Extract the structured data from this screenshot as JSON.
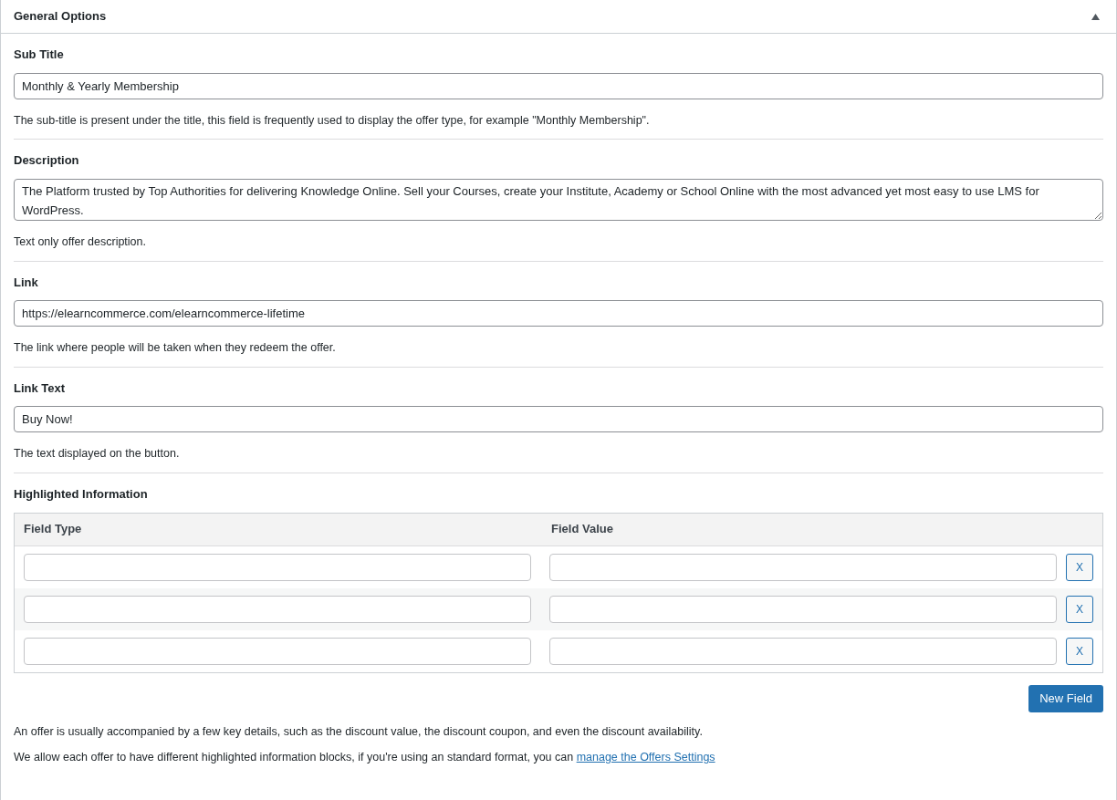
{
  "panel": {
    "title": "General Options",
    "expanded": true
  },
  "fields": [
    {
      "kind": "input",
      "label": "Sub Title",
      "value": "Monthly & Yearly Membership",
      "help": "The sub-title is present under the title, this field is frequently used to display the offer type, for example \"Monthly Membership\"."
    },
    {
      "kind": "textarea",
      "label": "Description",
      "value": "The Platform trusted by Top Authorities for delivering Knowledge Online. Sell your Courses, create your Institute, Academy or School Online with the most advanced yet most easy to use LMS for WordPress.",
      "help": "Text only offer description."
    },
    {
      "kind": "input",
      "label": "Link",
      "value": "https://elearncommerce.com/elearncommerce-lifetime",
      "help": "The link where people will be taken when they redeem the offer."
    },
    {
      "kind": "input",
      "label": "Link Text",
      "value": "Buy Now!",
      "help": "The text displayed on the button."
    }
  ],
  "highlighted": {
    "label": "Highlighted Information",
    "columns": [
      "Field Type",
      "Field Value"
    ],
    "rows": [
      {
        "remove": "X"
      },
      {
        "remove": "X"
      },
      {
        "remove": "X"
      }
    ],
    "new_button": "New Field",
    "note": "An offer is usually accompanied by a few key details, such as the discount value, the discount coupon, and even the discount availability.",
    "note_2": {
      "text": "We allow each offer to have different highlighted information blocks, if you're using an standard format, you can ",
      "link": "manage the Offers Settings"
    }
  }
}
